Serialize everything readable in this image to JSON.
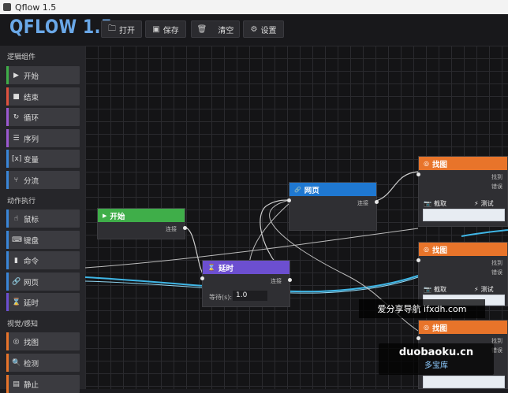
{
  "window": {
    "title": "Qflow 1.5"
  },
  "header": {
    "logo": "QFLOW 1.5",
    "buttons": [
      {
        "icon": "folder-open-icon",
        "label": "打开"
      },
      {
        "icon": "save-icon",
        "label": "保存"
      },
      {
        "icon": "trash-icon",
        "label": "清空"
      },
      {
        "icon": "gear-icon",
        "label": "设置"
      }
    ]
  },
  "sidebar": {
    "sections": [
      {
        "title": "逻辑组件",
        "items": [
          {
            "label": "开始",
            "icon": "play-icon",
            "color": "#3fae49"
          },
          {
            "label": "结束",
            "icon": "stop-icon",
            "color": "#e0523f"
          },
          {
            "label": "循环",
            "icon": "loop-icon",
            "color": "#9b59d0"
          },
          {
            "label": "序列",
            "icon": "sequence-icon",
            "color": "#9b59d0"
          },
          {
            "label": "变量",
            "icon": "variable-icon",
            "color": "#3a86d8"
          },
          {
            "label": "分流",
            "icon": "branch-icon",
            "color": "#3a86d8"
          }
        ]
      },
      {
        "title": "动作执行",
        "items": [
          {
            "label": "鼠标",
            "icon": "mouse-icon",
            "color": "#3a86d8"
          },
          {
            "label": "键盘",
            "icon": "keyboard-icon",
            "color": "#3a86d8"
          },
          {
            "label": "命令",
            "icon": "command-icon",
            "color": "#3a86d8"
          },
          {
            "label": "网页",
            "icon": "link-icon",
            "color": "#3a86d8"
          },
          {
            "label": "延时",
            "icon": "hourglass-icon",
            "color": "#6c4fd0"
          }
        ]
      },
      {
        "title": "视觉/感知",
        "items": [
          {
            "label": "找图",
            "icon": "find-image-icon",
            "color": "#e8742a"
          },
          {
            "label": "检测",
            "icon": "detect-icon",
            "color": "#e8742a"
          },
          {
            "label": "静止",
            "icon": "still-icon",
            "color": "#e8742a"
          }
        ]
      }
    ]
  },
  "nodes": {
    "start": {
      "title": "开始",
      "out_label": "连接",
      "color": "#3fae49"
    },
    "delay": {
      "title": "延时",
      "out_label": "连接",
      "field_label": "等待(s):",
      "field_value": "1.0",
      "color": "#6c4fd0"
    },
    "web": {
      "title": "网页",
      "out_label": "连接",
      "color": "#1f78d1"
    },
    "find1": {
      "title": "找图",
      "out1": "找到",
      "out2": "错误",
      "shot": "截取",
      "test": "测试",
      "color": "#e8742a"
    },
    "find2": {
      "title": "找图",
      "out1": "找到",
      "out2": "错误",
      "shot": "截取",
      "test": "测试",
      "color": "#e8742a"
    },
    "find3": {
      "title": "找图",
      "out1": "找到",
      "out2": "错误",
      "color": "#e8742a"
    }
  },
  "watermark": {
    "line1": "爱分享导航 ifxdh.com",
    "line2": "duobaoku.cn",
    "line3": "多宝库"
  }
}
